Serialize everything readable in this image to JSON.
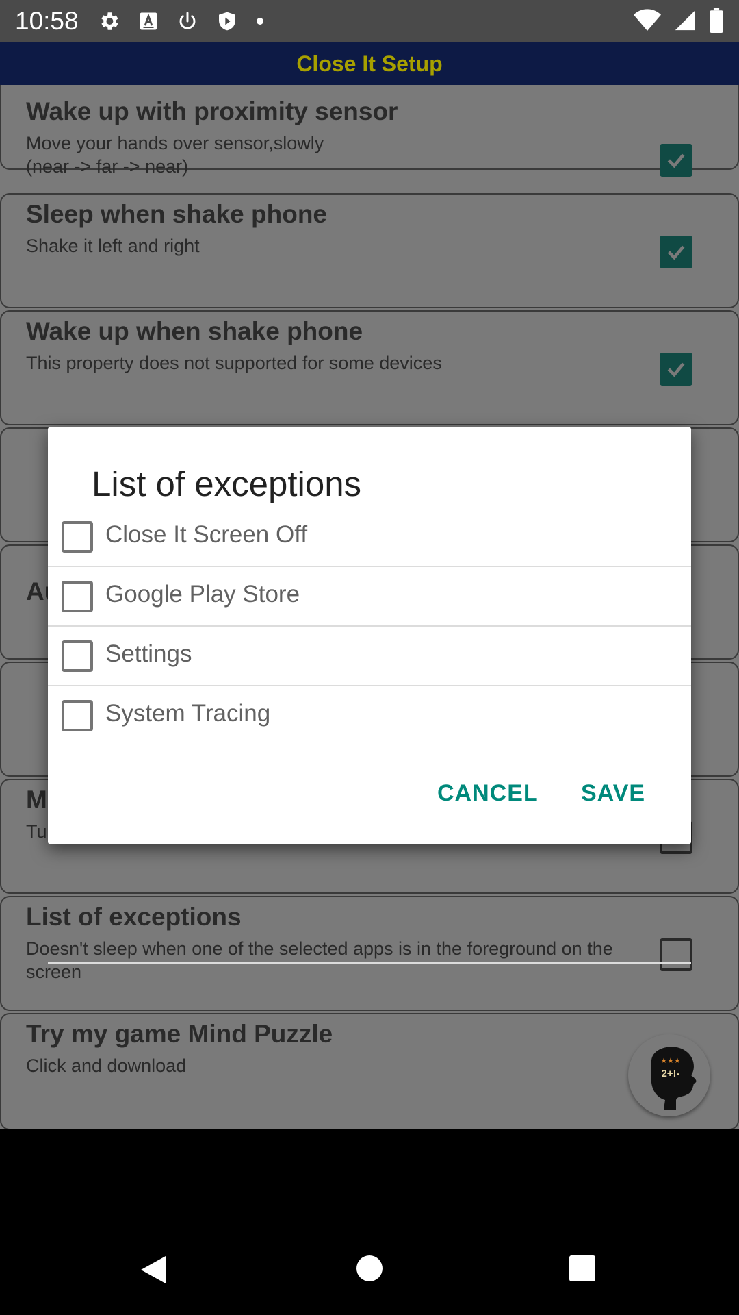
{
  "status_bar": {
    "time": "10:58",
    "icons": [
      "gear-icon",
      "a-icon",
      "power-icon",
      "shield-play-icon",
      "dot-icon",
      "wifi-icon",
      "signal-icon",
      "battery-icon"
    ]
  },
  "app_bar": {
    "title": "Close It Setup"
  },
  "settings": [
    {
      "title": "Wake up with proximity sensor",
      "desc": "Move your hands over sensor,slowly\n(near -> far -> near)",
      "checked": true
    },
    {
      "title": "Sleep when shake phone",
      "desc": "Shake it left and right",
      "checked": true
    },
    {
      "title": "Wake up when shake phone",
      "desc": "This property does not supported for some devices",
      "checked": true
    },
    {
      "title": "",
      "desc": "",
      "checked": null
    },
    {
      "title": "Au",
      "desc": "",
      "checked": null
    },
    {
      "title": "",
      "desc": "",
      "checked": null
    },
    {
      "title": "M",
      "desc": "Tu",
      "checked": false
    },
    {
      "title": "List of exceptions",
      "desc": "Doesn't sleep when one of the selected apps is in the foreground on the screen",
      "checked": false
    },
    {
      "title": "Try my game Mind Puzzle",
      "desc": "Click and download",
      "checked": null
    }
  ],
  "dialog": {
    "title": "List of exceptions",
    "options": [
      {
        "label": "Close It Screen Off",
        "checked": false
      },
      {
        "label": "Google Play Store",
        "checked": false
      },
      {
        "label": "Settings",
        "checked": false
      },
      {
        "label": "System Tracing",
        "checked": false
      }
    ],
    "cancel_label": "CANCEL",
    "save_label": "SAVE"
  },
  "game_avatar": {
    "text": "2+!-"
  },
  "colors": {
    "accent": "#00897b",
    "app_bar_bg": "#0d1a45",
    "app_title": "#a7a000",
    "checked_box": "#104a44"
  }
}
